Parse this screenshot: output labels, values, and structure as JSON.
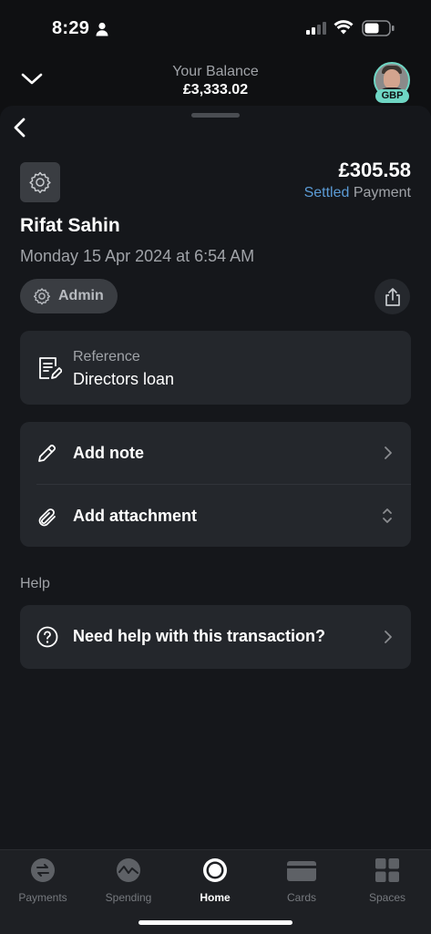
{
  "status_bar": {
    "time": "8:29"
  },
  "header": {
    "balance_label": "Your Balance",
    "balance_value": "£3,333.02",
    "currency_badge": "GBP"
  },
  "transaction": {
    "amount": "£305.58",
    "status": "Settled",
    "type": "Payment",
    "merchant": "Rifat Sahin",
    "date": "Monday 15 Apr 2024 at 6:54 AM",
    "category": "Admin"
  },
  "reference": {
    "label": "Reference",
    "value": "Directors loan"
  },
  "actions": {
    "add_note": "Add note",
    "add_attachment": "Add attachment"
  },
  "help": {
    "heading": "Help",
    "need_help": "Need help with this transaction?"
  },
  "tabs": [
    {
      "label": "Payments",
      "icon": "payments-icon"
    },
    {
      "label": "Spending",
      "icon": "spending-icon"
    },
    {
      "label": "Home",
      "icon": "home-icon",
      "active": true
    },
    {
      "label": "Cards",
      "icon": "cards-icon"
    },
    {
      "label": "Spaces",
      "icon": "spaces-icon"
    }
  ],
  "colors": {
    "accent_teal": "#6fd6c4",
    "settled_blue": "#5b9bd5",
    "card_bg": "#24272c"
  }
}
